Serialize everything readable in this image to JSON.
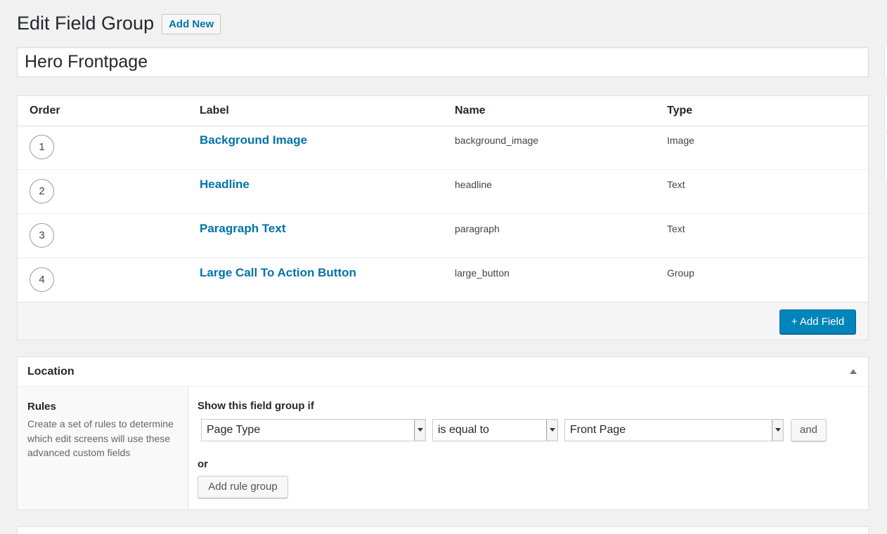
{
  "header": {
    "title": "Edit Field Group",
    "add_new_label": "Add New"
  },
  "title_field": {
    "value": "Hero Frontpage"
  },
  "fields_table": {
    "columns": [
      "Order",
      "Label",
      "Name",
      "Type"
    ],
    "rows": [
      {
        "order": "1",
        "label": "Background Image",
        "name": "background_image",
        "type": "Image"
      },
      {
        "order": "2",
        "label": "Headline",
        "name": "headline",
        "type": "Text"
      },
      {
        "order": "3",
        "label": "Paragraph Text",
        "name": "paragraph",
        "type": "Text"
      },
      {
        "order": "4",
        "label": "Large Call To Action Button",
        "name": "large_button",
        "type": "Group"
      }
    ],
    "add_field_label": "+ Add Field"
  },
  "location": {
    "title": "Location",
    "rules_title": "Rules",
    "rules_description": "Create a set of rules to determine which edit screens will use these advanced custom fields",
    "show_if": "Show this field group if",
    "rule": {
      "param": "Page Type",
      "operator": "is equal to",
      "value": "Front Page"
    },
    "and_label": "and",
    "or_label": "or",
    "add_rule_group_label": "Add rule group"
  }
}
